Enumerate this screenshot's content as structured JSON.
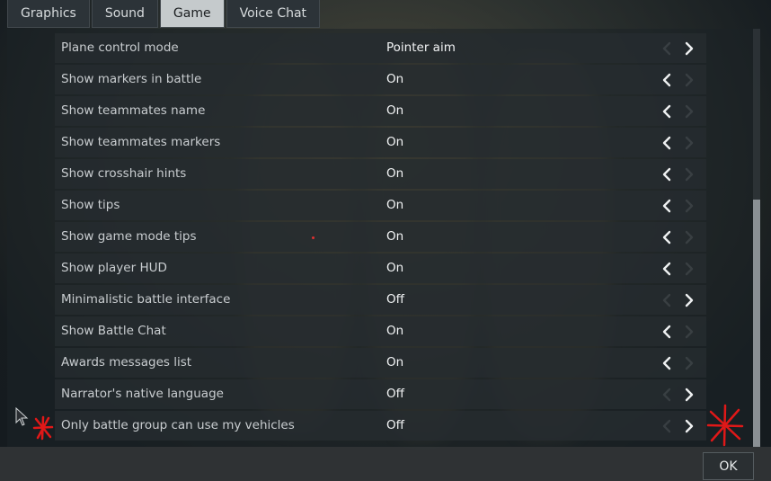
{
  "tabs": [
    {
      "label": "Graphics",
      "active": false
    },
    {
      "label": "Sound",
      "active": false
    },
    {
      "label": "Game",
      "active": true
    },
    {
      "label": "Voice Chat",
      "active": false
    }
  ],
  "settings": [
    {
      "label": "Plane control mode",
      "value": "Pointer aim",
      "left_enabled": false,
      "right_enabled": true
    },
    {
      "label": "Show markers in battle",
      "value": "On",
      "left_enabled": true,
      "right_enabled": false
    },
    {
      "label": "Show teammates name",
      "value": "On",
      "left_enabled": true,
      "right_enabled": false
    },
    {
      "label": "Show teammates markers",
      "value": "On",
      "left_enabled": true,
      "right_enabled": false
    },
    {
      "label": "Show crosshair hints",
      "value": "On",
      "left_enabled": true,
      "right_enabled": false
    },
    {
      "label": "Show tips",
      "value": "On",
      "left_enabled": true,
      "right_enabled": false
    },
    {
      "label": "Show game mode tips",
      "value": "On",
      "left_enabled": true,
      "right_enabled": false
    },
    {
      "label": "Show player HUD",
      "value": "On",
      "left_enabled": true,
      "right_enabled": false
    },
    {
      "label": "Minimalistic battle interface",
      "value": "Off",
      "left_enabled": false,
      "right_enabled": true
    },
    {
      "label": "Show Battle Chat",
      "value": "On",
      "left_enabled": true,
      "right_enabled": false
    },
    {
      "label": "Awards messages list",
      "value": "On",
      "left_enabled": true,
      "right_enabled": false
    },
    {
      "label": "Narrator's native language",
      "value": "Off",
      "left_enabled": false,
      "right_enabled": true
    },
    {
      "label": "Only battle group can use my vehicles",
      "value": "Off",
      "left_enabled": false,
      "right_enabled": true
    }
  ],
  "footer": {
    "ok_label": "OK"
  },
  "icons": {
    "left": "chevron-left-icon",
    "right": "chevron-right-icon"
  },
  "colors": {
    "active_tab": "#c5cacc",
    "annotation": "#e01818"
  }
}
